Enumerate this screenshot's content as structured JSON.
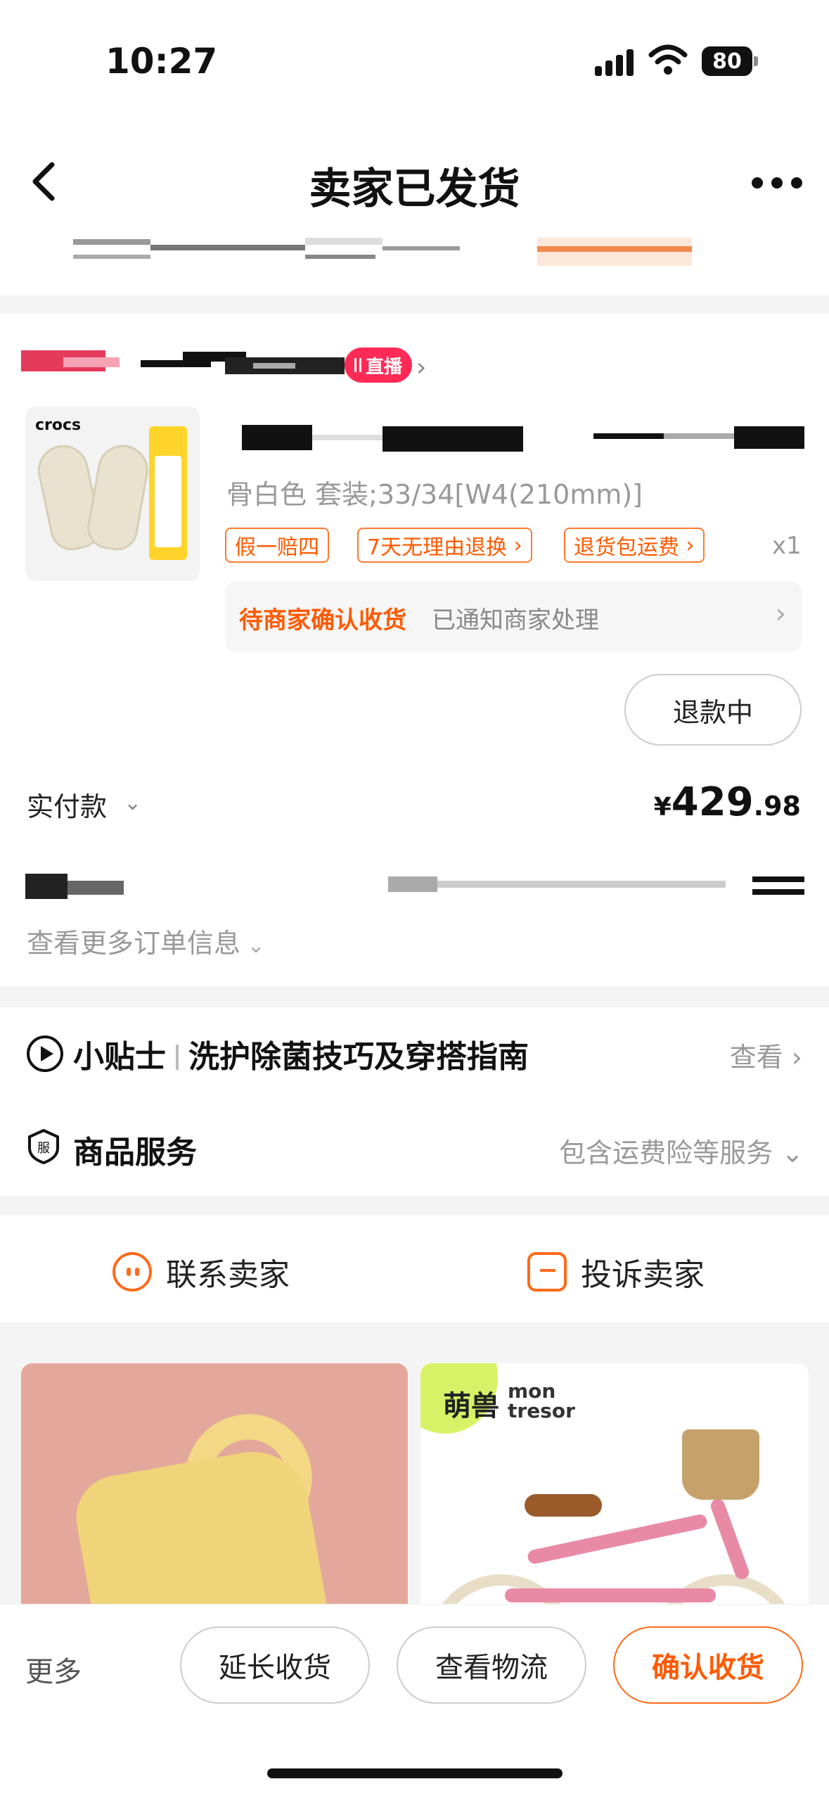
{
  "status_bar": {
    "time": "10:27",
    "battery": "80"
  },
  "header": {
    "title": "卖家已发货"
  },
  "order": {
    "live_badge": "直播",
    "product": {
      "brand": "crocs",
      "variant": "骨白色 套装;33/34[W4(210mm)]",
      "tags": [
        "假一赔四",
        "7天无理由退换",
        "退货包运费"
      ],
      "quantity": "x1"
    },
    "notice": {
      "status": "待商家确认收货",
      "detail": "已通知商家处理"
    },
    "refund_button": "退款中",
    "paid_label": "实付款",
    "price": {
      "currency": "¥",
      "integer": "429",
      "decimal": ".98"
    },
    "more_info": "查看更多订单信息"
  },
  "tips": {
    "prefix": "小贴士",
    "title": "洗护除菌技巧及穿搭指南",
    "action": "查看"
  },
  "service": {
    "title": "商品服务",
    "summary": "包含运费险等服务"
  },
  "contact": {
    "seller": "联系卖家",
    "complain": "投诉卖家"
  },
  "recommend": {
    "brand_cn": "萌兽",
    "brand_en_1": "mon",
    "brand_en_2": "tresor"
  },
  "bottom_bar": {
    "more": "更多",
    "extend": "延长收货",
    "logistics": "查看物流",
    "confirm": "确认收货"
  },
  "colors": {
    "accent": "#ff5a00",
    "live": "#ff2a55"
  }
}
